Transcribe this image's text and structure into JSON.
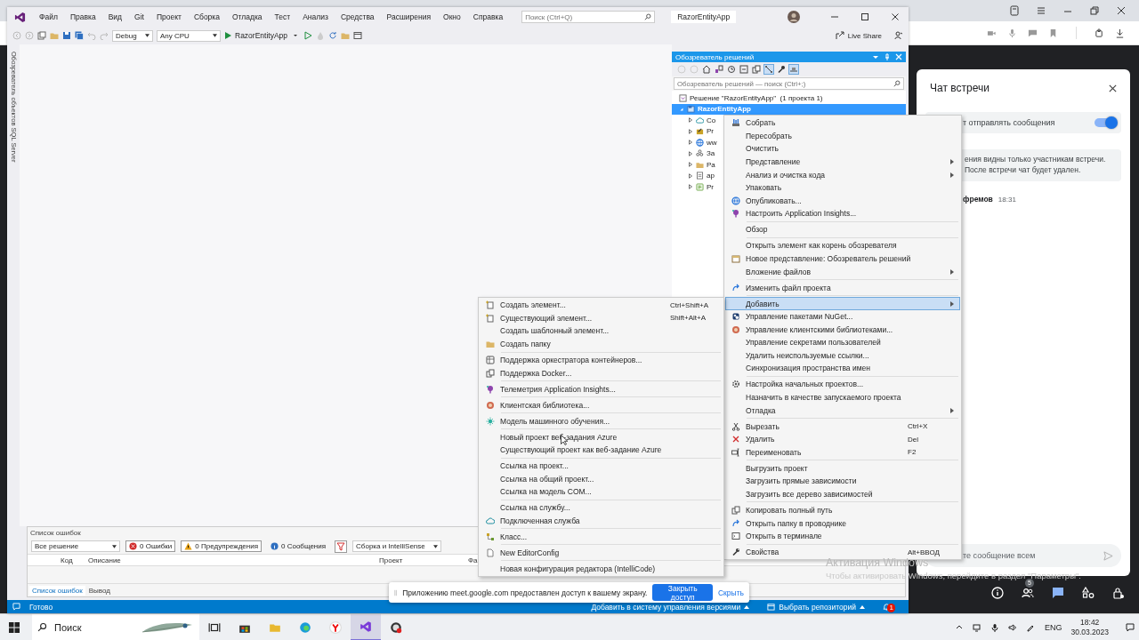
{
  "vs": {
    "menu": [
      "Файл",
      "Правка",
      "Вид",
      "Git",
      "Проект",
      "Сборка",
      "Отладка",
      "Тест",
      "Анализ",
      "Средства",
      "Расширения",
      "Окно",
      "Справка"
    ],
    "search_placeholder": "Поиск (Ctrl+Q)",
    "solution_badge": "RazorEntityApp",
    "toolbar": {
      "configuration": "Debug",
      "platform": "Any CPU",
      "start_target": "RazorEntityApp",
      "live_share": "Live Share"
    },
    "side_tab": "Обозреватель объектов SQL Server",
    "solution_explorer": {
      "title": "Обозреватель решений",
      "search_placeholder": "Обозреватель решений — поиск (Ctrl+;)",
      "solution": {
        "label": "Решение \"RazorEntityApp\"  (1 проекта 1)",
        "selected": false
      },
      "project": {
        "label": "RazorEntityApp",
        "selected": true,
        "expanded": true,
        "children": [
          {
            "label": "Co",
            "kind": "cloud",
            "selected": false,
            "expanded": false
          },
          {
            "label": "Pr",
            "kind": "props",
            "selected": false,
            "expanded": false
          },
          {
            "label": "ww",
            "kind": "globe",
            "selected": false,
            "expanded": false
          },
          {
            "label": "За",
            "kind": "deps",
            "selected": false,
            "expanded": false
          },
          {
            "label": "Pa",
            "kind": "folder",
            "selected": false,
            "expanded": false
          },
          {
            "label": "ap",
            "kind": "json",
            "selected": false,
            "expanded": false
          },
          {
            "label": "Pr",
            "kind": "csharp",
            "selected": false,
            "expanded": false
          }
        ]
      }
    },
    "error_list": {
      "title": "Список ошибок",
      "scope": "Все решение",
      "filters": [
        {
          "kind": "error",
          "label": "0 Ошибки",
          "on": true
        },
        {
          "kind": "warning",
          "label": "0 Предупреждения",
          "on": true
        },
        {
          "kind": "info",
          "label": "0 Сообщения",
          "on": false
        }
      ],
      "source": "Сборка и IntelliSense",
      "columns": [
        "Код",
        "Описание",
        "Проект",
        "Фа"
      ],
      "tabs": [
        {
          "label": "Список ошибок",
          "selected": true
        },
        {
          "label": "Вывод",
          "selected": false
        }
      ]
    },
    "status_bar": {
      "text": "Готово",
      "source_control": "Добавить в систему управления версиями",
      "repository": "Выбрать репозиторий",
      "notifications": "1"
    }
  },
  "context_menu": {
    "groups": [
      [
        {
          "label": "Собрать",
          "kind": "build",
          "selected": false
        },
        {
          "label": "Пересобрать",
          "selected": false
        },
        {
          "label": "Очистить",
          "selected": false
        },
        {
          "label": "Представление",
          "submenu": true,
          "selected": false
        },
        {
          "label": "Анализ и очистка кода",
          "submenu": true,
          "selected": false
        },
        {
          "label": "Упаковать",
          "selected": false
        },
        {
          "label": "Опубликовать...",
          "kind": "globe",
          "selected": false
        },
        {
          "label": "Настроить Application Insights...",
          "kind": "insights",
          "selected": false
        }
      ],
      [
        {
          "label": "Обзор",
          "selected": false
        }
      ],
      [
        {
          "label": "Открыть элемент как корень обозревателя",
          "selected": false
        },
        {
          "label": "Новое представление: Обозреватель решений",
          "kind": "window",
          "selected": false
        },
        {
          "label": "Вложение файлов",
          "submenu": true,
          "selected": false
        }
      ],
      [
        {
          "label": "Изменить файл проекта",
          "kind": "arrow",
          "selected": false
        }
      ],
      [
        {
          "label": "Добавить",
          "submenu": true,
          "selected": true
        },
        {
          "label": "Управление пакетами NuGet...",
          "kind": "package",
          "selected": false
        },
        {
          "label": "Управление клиентскими библиотеками...",
          "kind": "library",
          "selected": false
        },
        {
          "label": "Управление секретами пользователей",
          "selected": false
        },
        {
          "label": "Удалить неиспользуемые ссылки...",
          "selected": false
        },
        {
          "label": "Синхронизация пространства имен",
          "selected": false
        }
      ],
      [
        {
          "label": "Настройка начальных проектов...",
          "kind": "gear",
          "selected": false
        },
        {
          "label": "Назначить в качестве запускаемого проекта",
          "selected": false
        },
        {
          "label": "Отладка",
          "submenu": true,
          "selected": false
        }
      ],
      [
        {
          "label": "Вырезать",
          "kind": "cut",
          "shortcut": "Ctrl+X",
          "selected": false
        },
        {
          "label": "Удалить",
          "kind": "delete",
          "shortcut": "Del",
          "selected": false
        },
        {
          "label": "Переименовать",
          "kind": "rename",
          "shortcut": "F2",
          "selected": false
        }
      ],
      [
        {
          "label": "Выгрузить проект",
          "selected": false
        },
        {
          "label": "Загрузить прямые зависимости",
          "selected": false
        },
        {
          "label": "Загрузить все дерево зависимостей",
          "selected": false
        }
      ],
      [
        {
          "label": "Копировать полный путь",
          "kind": "copy",
          "selected": false
        },
        {
          "label": "Открыть папку в проводнике",
          "kind": "arrow",
          "selected": false
        },
        {
          "label": "Открыть в терминале",
          "kind": "terminal",
          "selected": false
        }
      ],
      [
        {
          "label": "Свойства",
          "kind": "wrench",
          "shortcut": "Alt+ВВОД",
          "selected": false
        }
      ]
    ]
  },
  "add_submenu": {
    "groups": [
      [
        {
          "label": "Создать элемент...",
          "kind": "newitem",
          "shortcut": "Ctrl+Shift+A",
          "selected": false
        },
        {
          "label": "Существующий элемент...",
          "kind": "newitem",
          "shortcut": "Shift+Alt+A",
          "selected": false
        },
        {
          "label": "Создать шаблонный элемент...",
          "selected": false
        },
        {
          "label": "Создать папку",
          "kind": "folder",
          "selected": false
        }
      ],
      [
        {
          "label": "Поддержка оркестратора контейнеров...",
          "kind": "container",
          "selected": false
        },
        {
          "label": "Поддержка Docker...",
          "kind": "copy",
          "selected": false
        }
      ],
      [
        {
          "label": "Телеметрия Application Insights...",
          "kind": "insights",
          "selected": false
        }
      ],
      [
        {
          "label": "Клиентская библиотека...",
          "kind": "library",
          "selected": false
        }
      ],
      [
        {
          "label": "Модель машинного обучения...",
          "kind": "ml",
          "selected": false
        }
      ],
      [
        {
          "label": "Новый проект веб-задания Azure",
          "selected": false
        },
        {
          "label": "Существующий проект как веб-задание Azure",
          "selected": false
        }
      ],
      [
        {
          "label": "Ссылка на проект...",
          "selected": false
        },
        {
          "label": "Ссылка на общий проект...",
          "selected": false
        },
        {
          "label": "Ссылка на модель COM...",
          "selected": false
        }
      ],
      [
        {
          "label": "Ссылка на службу...",
          "selected": false
        },
        {
          "label": "Подключенная служба",
          "kind": "cloud",
          "selected": false
        }
      ],
      [
        {
          "label": "Класс...",
          "kind": "class",
          "selected": false
        }
      ],
      [
        {
          "label": "New EditorConfig",
          "kind": "file",
          "selected": false
        }
      ],
      [
        {
          "label": "Новая конфигурация редактора (IntelliCode)",
          "selected": false
        }
      ]
    ]
  },
  "share_notice": {
    "text": "Приложению meet.google.com предоставлен доступ к вашему экрану.",
    "primary": "Закрыть доступ",
    "secondary": "Скрыть"
  },
  "activation": {
    "title": "Активация Windows",
    "text": "Чтобы активировать Windows, перейдите в раздел \"Параметры\"."
  },
  "meet": {
    "chat": {
      "title": "Чат встречи",
      "permission": {
        "label": "т отправлять сообщения",
        "on": true
      },
      "notice": [
        "ения видны только участникам встречи.",
        "После встречи чат будет удален."
      ],
      "message": {
        "author": "фремов",
        "time": "18:31"
      },
      "input_placeholder": "те сообщение всем"
    },
    "participants_badge": "5"
  },
  "taskbar": {
    "search_placeholder": "Поиск",
    "language": "ENG",
    "time": "18:42",
    "date": "30.03.2023"
  }
}
